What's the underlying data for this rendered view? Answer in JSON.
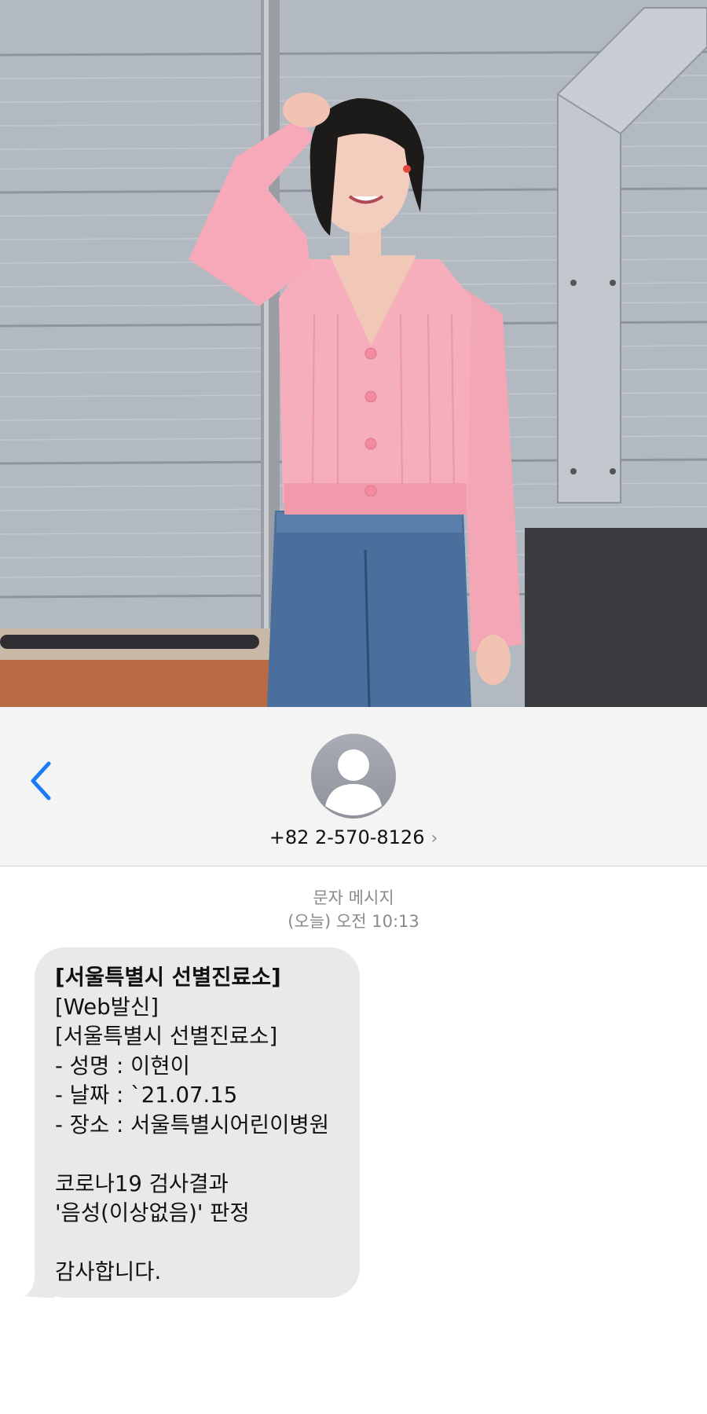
{
  "header": {
    "contact_number": "+82 2-570-8126",
    "back_icon": "chevron-left-icon",
    "avatar_icon": "person-silhouette-icon",
    "disclosure_icon": "chevron-right-icon",
    "accent_color": "#1a7cf5"
  },
  "thread": {
    "message_type": "문자 메시지",
    "timestamp": "(오늘) 오전 10:13"
  },
  "message": {
    "bubble_color": "#e9e9eb",
    "lines": [
      "[서울특별시 선별진료소]",
      "[Web발신]",
      "[서울특별시 선별진료소]",
      "- 성명 : 이현이",
      "- 날짜 : `21.07.15",
      "- 장소 : 서울특별시어린이병원",
      "",
      "코로나19 검사결과",
      "'음성(이상없음)' 판정",
      "",
      "감사합니다."
    ]
  },
  "photo": {
    "description_icon": "photo-woman-pink-cardigan"
  }
}
